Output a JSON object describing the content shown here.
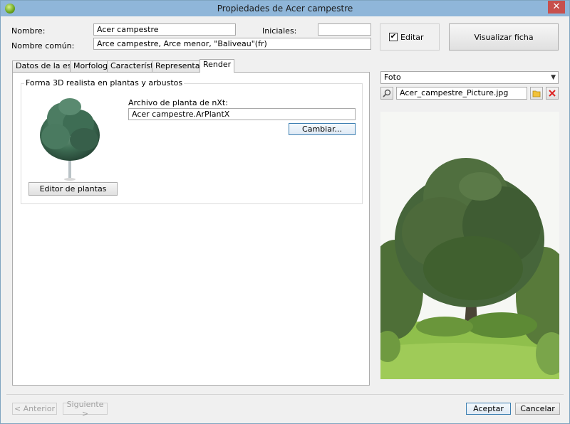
{
  "window": {
    "title": "Propiedades de Acer campestre",
    "close_label": "✕"
  },
  "form": {
    "nombre_label": "Nombre:",
    "nombre_value": "Acer campestre",
    "iniciales_label": "Iniciales:",
    "iniciales_value": "",
    "nombre_comun_label": "Nombre común:",
    "nombre_comun_value": "Arce campestre, Arce menor, \"Baliveau\"(fr)",
    "editar_label": "Editar",
    "editar_checked": true,
    "visualizar_label": "Visualizar ficha"
  },
  "tabs": [
    {
      "label": "Datos de la especie",
      "active": false
    },
    {
      "label": "Morfología",
      "active": false
    },
    {
      "label": "Características",
      "active": false
    },
    {
      "label": "Representación",
      "active": false
    },
    {
      "label": "Render",
      "active": true
    }
  ],
  "render": {
    "group_title": "Forma 3D realista en plantas y arbustos",
    "archivo_label": "Archivo de planta de nXt:",
    "archivo_value": "Acer campestre.ArPlantX",
    "cambiar_label": "Cambiar...",
    "editor_label": "Editor de plantas"
  },
  "media": {
    "type_selected": "Foto",
    "file_name": "Acer_campestre_Picture.jpg",
    "icons": [
      "search-icon",
      "folder-icon",
      "delete-icon"
    ]
  },
  "footer": {
    "anterior_label": "< Anterior",
    "siguiente_label": "Siguiente >",
    "aceptar_label": "Aceptar",
    "cancelar_label": "Cancelar"
  },
  "colors": {
    "titlebar": "#8fb6d9",
    "close": "#c7504d",
    "focus_border": "#3c7fb1"
  }
}
